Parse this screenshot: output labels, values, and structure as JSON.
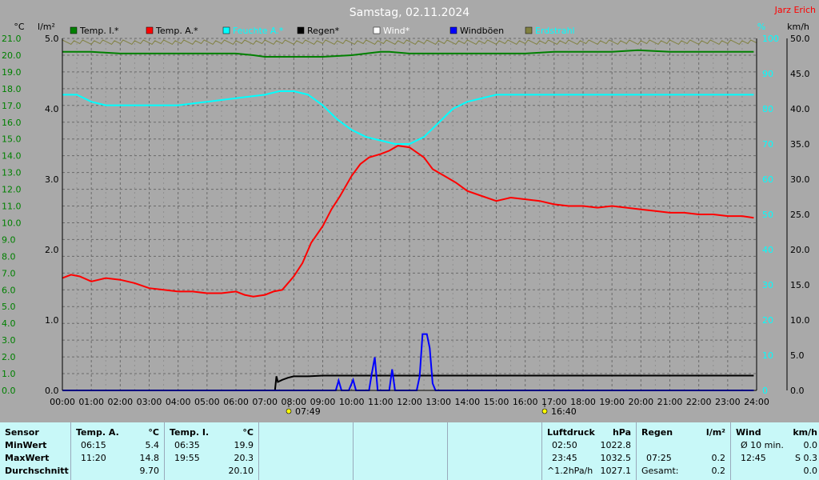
{
  "title": "Samstag, 02.11.2024",
  "author": "Jarz Erich",
  "legend": [
    {
      "label": "Temp. I.*",
      "color": "#008000",
      "text_color": "#000000"
    },
    {
      "label": "Temp. A.*",
      "color": "#ff0000",
      "text_color": "#000000"
    },
    {
      "label": "Feuchte A.*",
      "color": "#00ffff",
      "text_color": "#00ffff"
    },
    {
      "label": "Regen*",
      "color": "#000000",
      "text_color": "#000000"
    },
    {
      "label": "Wind*",
      "color": "#ffffff",
      "text_color": "#ffffff"
    },
    {
      "label": "Windböen",
      "color": "#0000ff",
      "text_color": "#000000"
    },
    {
      "label": "Erdstrahl",
      "color": "#808040",
      "text_color": "#00ffff"
    }
  ],
  "units": {
    "temp": "°C",
    "rain": "l/m²",
    "humidity": "%",
    "wind": "km/h"
  },
  "sunrise": "07:49",
  "sunset": "16:40",
  "chart_data": {
    "type": "line",
    "x_ticks": [
      "00:00",
      "01:00",
      "02:00",
      "03:00",
      "04:00",
      "05:00",
      "06:00",
      "07:00",
      "08:00",
      "09:00",
      "10:00",
      "11:00",
      "12:00",
      "13:00",
      "14:00",
      "15:00",
      "16:00",
      "17:00",
      "18:00",
      "19:00",
      "20:00",
      "21:00",
      "22:00",
      "23:00",
      "24:00"
    ],
    "y_left_temp": {
      "ticks": [
        "0.0",
        "1.0",
        "2.0",
        "3.0",
        "4.0",
        "5.0",
        "6.0",
        "7.0",
        "8.0",
        "9.0",
        "10.0",
        "11.0",
        "12.0",
        "13.0",
        "14.0",
        "15.0",
        "16.0",
        "17.0",
        "18.0",
        "19.0",
        "20.0",
        "21.0"
      ],
      "ylim": [
        0,
        21
      ]
    },
    "y_left_rain": {
      "ticks": [
        "0.0",
        "1.0",
        "2.0",
        "3.0",
        "4.0",
        "5.0"
      ],
      "ylim": [
        0,
        5
      ]
    },
    "y_right_humidity": {
      "ticks": [
        "0",
        "10",
        "20",
        "30",
        "40",
        "50",
        "60",
        "70",
        "80",
        "90",
        "100"
      ],
      "ylim": [
        0,
        100
      ]
    },
    "y_right_wind": {
      "ticks": [
        "0.0",
        "5.0",
        "10.0",
        "15.0",
        "20.0",
        "25.0",
        "30.0",
        "35.0",
        "40.0",
        "45.0",
        "50.0"
      ],
      "ylim": [
        0,
        50
      ]
    },
    "series": [
      {
        "name": "Temp. A.*",
        "axis": "temp",
        "color": "#ff0000",
        "x": [
          0,
          0.3,
          0.6,
          1.0,
          1.5,
          2.0,
          2.5,
          3.0,
          3.5,
          4.0,
          4.5,
          5.0,
          5.5,
          6.0,
          6.3,
          6.6,
          7.0,
          7.3,
          7.6,
          8.0,
          8.3,
          8.6,
          9.0,
          9.3,
          9.6,
          10.0,
          10.3,
          10.6,
          11.0,
          11.3,
          11.6,
          12.0,
          12.5,
          12.8,
          13.2,
          13.6,
          14.0,
          14.5,
          15.0,
          15.5,
          16.0,
          16.5,
          17.0,
          17.5,
          18.0,
          18.5,
          19.0,
          19.5,
          20.0,
          20.5,
          21.0,
          21.5,
          22.0,
          22.5,
          23.0,
          23.5,
          23.9
        ],
        "y": [
          6.7,
          6.9,
          6.8,
          6.5,
          6.7,
          6.6,
          6.4,
          6.1,
          6.0,
          5.9,
          5.9,
          5.8,
          5.8,
          5.9,
          5.7,
          5.6,
          5.7,
          5.9,
          6.0,
          6.8,
          7.6,
          8.8,
          9.8,
          10.8,
          11.6,
          12.8,
          13.5,
          13.9,
          14.1,
          14.3,
          14.6,
          14.5,
          13.9,
          13.2,
          12.8,
          12.4,
          11.9,
          11.6,
          11.3,
          11.5,
          11.4,
          11.3,
          11.1,
          11.0,
          11.0,
          10.9,
          11.0,
          10.9,
          10.8,
          10.7,
          10.6,
          10.6,
          10.5,
          10.5,
          10.4,
          10.4,
          10.3
        ]
      },
      {
        "name": "Temp. I.*",
        "axis": "temp",
        "color": "#008000",
        "x": [
          0,
          1,
          2,
          3,
          4,
          5,
          6,
          6.6,
          7,
          8,
          9,
          10,
          11,
          11.3,
          12,
          13,
          14,
          15,
          16,
          17,
          18,
          19,
          19.9,
          21,
          22,
          23,
          23.9
        ],
        "y": [
          20.2,
          20.2,
          20.1,
          20.1,
          20.1,
          20.1,
          20.1,
          20.0,
          19.9,
          19.9,
          19.9,
          20.0,
          20.2,
          20.2,
          20.1,
          20.1,
          20.1,
          20.1,
          20.1,
          20.2,
          20.2,
          20.2,
          20.3,
          20.2,
          20.2,
          20.2,
          20.2
        ]
      },
      {
        "name": "Feuchte A.*",
        "axis": "humidity",
        "color": "#00ffff",
        "x": [
          0,
          0.5,
          1,
          1.5,
          2,
          3,
          4,
          5,
          6,
          7,
          7.5,
          8,
          8.5,
          9,
          9.5,
          10,
          10.5,
          11,
          11.5,
          12,
          12.5,
          13,
          13.5,
          14,
          15,
          16,
          17,
          18,
          19,
          20,
          21,
          22,
          23,
          23.9
        ],
        "y": [
          84,
          84,
          82,
          81,
          81,
          81,
          81,
          82,
          83,
          84,
          85,
          85,
          84,
          81,
          77,
          74,
          72,
          71,
          70,
          70,
          72,
          76,
          80,
          82,
          84,
          84,
          84,
          84,
          84,
          84,
          84,
          84,
          84,
          84
        ]
      },
      {
        "name": "Regen*",
        "axis": "rain",
        "color": "#000000",
        "x": [
          0,
          7.35,
          7.4,
          7.45,
          7.6,
          7.8,
          8.0,
          8.5,
          9.0,
          12.0,
          16.0,
          20.0,
          23.9
        ],
        "y": [
          0.0,
          0.0,
          0.2,
          0.12,
          0.15,
          0.18,
          0.2,
          0.2,
          0.21,
          0.21,
          0.21,
          0.21,
          0.21
        ]
      },
      {
        "name": "Windböen",
        "axis": "wind",
        "color": "#0000ff",
        "x": [
          0,
          9.45,
          9.55,
          9.65,
          9.9,
          10.05,
          10.15,
          10.6,
          10.7,
          10.8,
          10.9,
          11.3,
          11.4,
          11.5,
          11.6,
          12.25,
          12.35,
          12.45,
          12.6,
          12.7,
          12.8,
          12.9,
          23.9
        ],
        "y": [
          0,
          0,
          1.4,
          0,
          0,
          1.5,
          0,
          0,
          2.5,
          4.7,
          0,
          0,
          3.0,
          0,
          0,
          0,
          2.0,
          8.0,
          8.0,
          6.0,
          1.0,
          0,
          0
        ]
      }
    ]
  },
  "stats": {
    "sensor": {
      "title": "Sensor",
      "rows": [
        "MinWert",
        "MaxWert",
        "Durchschnitt"
      ]
    },
    "temp_a": {
      "title": "Temp. A.",
      "unit": "°C",
      "rows": [
        [
          "06:15",
          "5.4"
        ],
        [
          "11:20",
          "14.8"
        ],
        [
          "",
          "9.70"
        ]
      ]
    },
    "temp_i": {
      "title": "Temp. I.",
      "unit": "°C",
      "rows": [
        [
          "06:35",
          "19.9"
        ],
        [
          "19:55",
          "20.3"
        ],
        [
          "",
          "20.10"
        ]
      ]
    },
    "pressure": {
      "title": "Luftdruck",
      "unit": "hPa",
      "rows": [
        [
          "02:50",
          "1022.8"
        ],
        [
          "23:45",
          "1032.5"
        ],
        [
          "^1.2hPa/h",
          "1027.1"
        ]
      ]
    },
    "rain": {
      "title": "Regen",
      "unit": "l/m²",
      "rows": [
        [
          "",
          ""
        ],
        [
          "07:25",
          "0.2"
        ],
        [
          "Gesamt:",
          "0.2"
        ]
      ]
    },
    "wind": {
      "title": "Wind",
      "unit": "km/h",
      "rows": [
        [
          "Ø 10 min.",
          "0.0"
        ],
        [
          "12:45",
          "S 0.3"
        ],
        [
          "",
          "0.0"
        ]
      ]
    }
  }
}
